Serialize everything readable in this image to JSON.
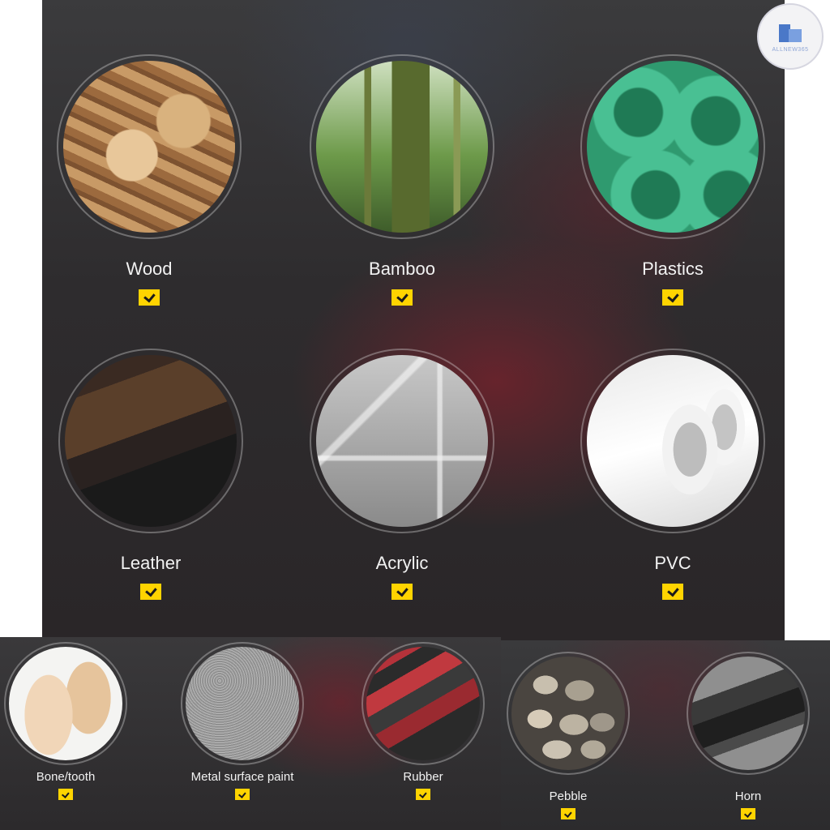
{
  "watermark": {
    "text": "ALLNEW365"
  },
  "materials_top": [
    {
      "id": "wood",
      "label": "Wood"
    },
    {
      "id": "bamboo",
      "label": "Bamboo"
    },
    {
      "id": "plastics",
      "label": "Plastics"
    },
    {
      "id": "leather",
      "label": "Leather"
    },
    {
      "id": "acrylic",
      "label": "Acrylic"
    },
    {
      "id": "pvc",
      "label": "PVC"
    }
  ],
  "materials_bottom_left": [
    {
      "id": "bone",
      "label": "Bone/tooth"
    },
    {
      "id": "metal",
      "label": "Metal surface paint"
    },
    {
      "id": "rubber",
      "label": "Rubber"
    }
  ],
  "materials_bottom_right": [
    {
      "id": "pebble",
      "label": "Pebble"
    },
    {
      "id": "horn",
      "label": "Horn"
    }
  ],
  "colors": {
    "check_yellow": "#ffd400",
    "label_white": "#f2f2f2"
  }
}
